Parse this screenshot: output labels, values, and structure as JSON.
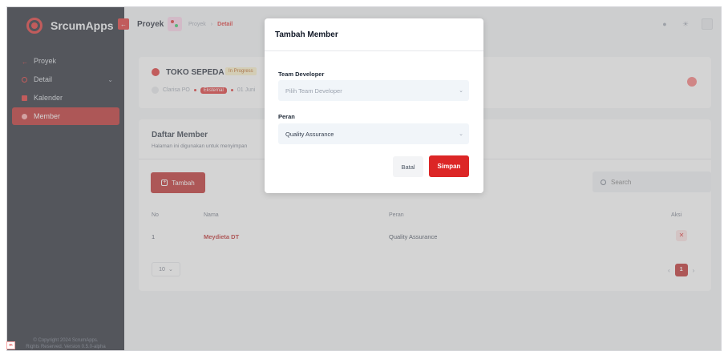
{
  "sidebar": {
    "brand": "SrcumApps",
    "items": [
      {
        "label": "Proyek",
        "icon": "arrow-left-icon"
      },
      {
        "label": "Detail",
        "icon": "circle-icon"
      },
      {
        "label": "Kalender",
        "icon": "calendar-icon"
      },
      {
        "label": "Member",
        "icon": "user-icon"
      }
    ],
    "footer_line1": "© Copyright 2024 ScrumApps.",
    "footer_line2": "Rights Reserved. Version 0.5.0-alpha"
  },
  "topbar": {
    "title": "Proyek",
    "breadcrumb": [
      "Proyek",
      "›",
      "Detail"
    ]
  },
  "project": {
    "name": "TOKO SEPEDA",
    "status": "In Progress",
    "owner": "Clarisa PO",
    "type": "Eksternal",
    "date": "01 Juni"
  },
  "members": {
    "title": "Daftar Member",
    "subtitle": "Halaman ini digunakan untuk menyimpan",
    "add_label": "Tambah",
    "search_placeholder": "Search",
    "columns": [
      "No",
      "Nama",
      "Peran",
      "Aksi"
    ],
    "rows": [
      {
        "no": "1",
        "name": "Meydieta DT",
        "role": "Quality Assurance"
      }
    ],
    "page_size": "10",
    "current_page": "1"
  },
  "modal": {
    "title": "Tambah Member",
    "dev_label": "Team Developer",
    "dev_placeholder": "Pilih Team Developer",
    "role_label": "Peran",
    "role_value": "Quality Assurance",
    "cancel_label": "Batal",
    "save_label": "Simpan"
  },
  "colors": {
    "accent": "#dc2626",
    "sidebar_bg": "#161a26"
  }
}
